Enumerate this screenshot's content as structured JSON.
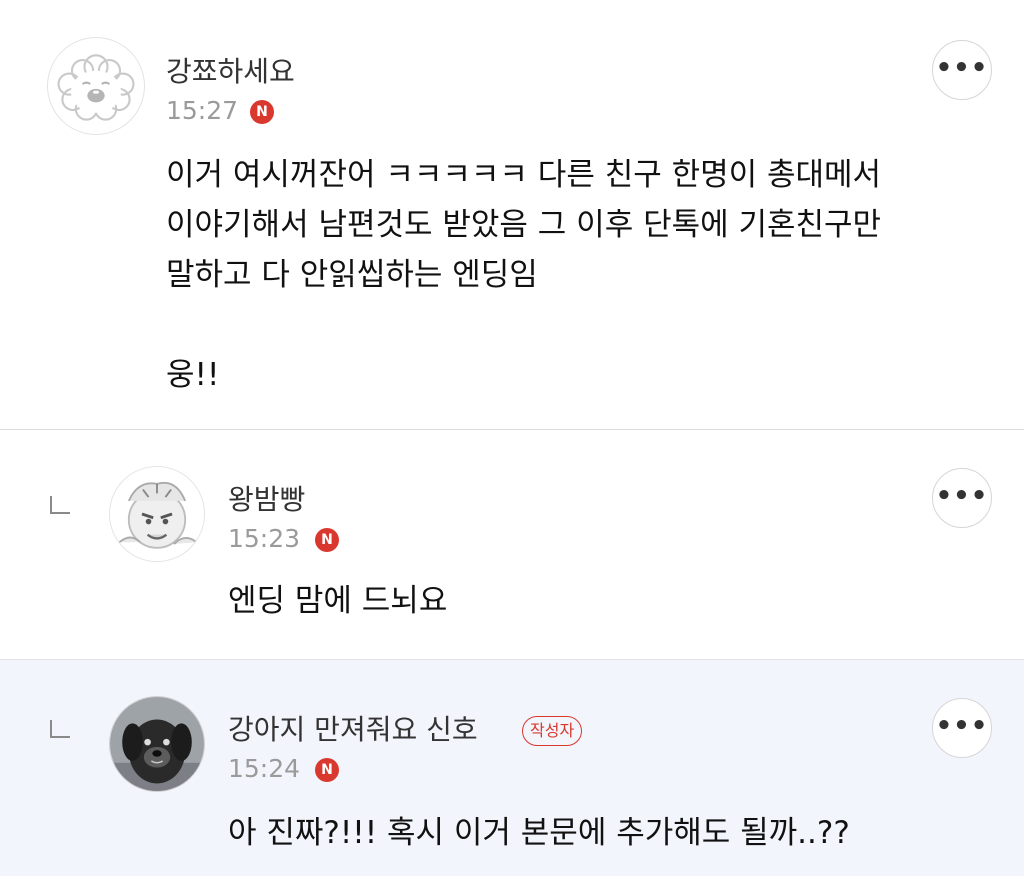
{
  "comments": [
    {
      "author": "강쬬하세요",
      "time": "15:27",
      "new_badge": "N",
      "avatar_icon": "fluffy-dog-illustration-icon",
      "body": "이거 여시꺼잔어 ㅋㅋㅋㅋㅋ 다른 친구 한명이 총대메서\n이야기해서 남편것도 받았음 그 이후 단톡에 기혼친구만\n말하고 다 안읽씹하는 엔딩임\n\n웅!!",
      "more_label": "•••"
    },
    {
      "author": "왕밤빵",
      "time": "15:23",
      "new_badge": "N",
      "avatar_icon": "cartoon-character-icon",
      "body": "엔딩 맘에 드뇌요",
      "more_label": "•••",
      "is_reply": true
    },
    {
      "author": "강아지 만져줘요 신호",
      "author_badge": "작성자",
      "time": "15:24",
      "new_badge": "N",
      "avatar_icon": "black-dog-photo-icon",
      "body": "아 진짜?!!! 혹시 이거 본문에 추가해도 될까..??",
      "more_label": "•••",
      "is_reply": true
    }
  ],
  "colors": {
    "badge_red": "#d9382f",
    "author_highlight_bg": "#f2f5fb",
    "divider": "#dcdcdc"
  }
}
